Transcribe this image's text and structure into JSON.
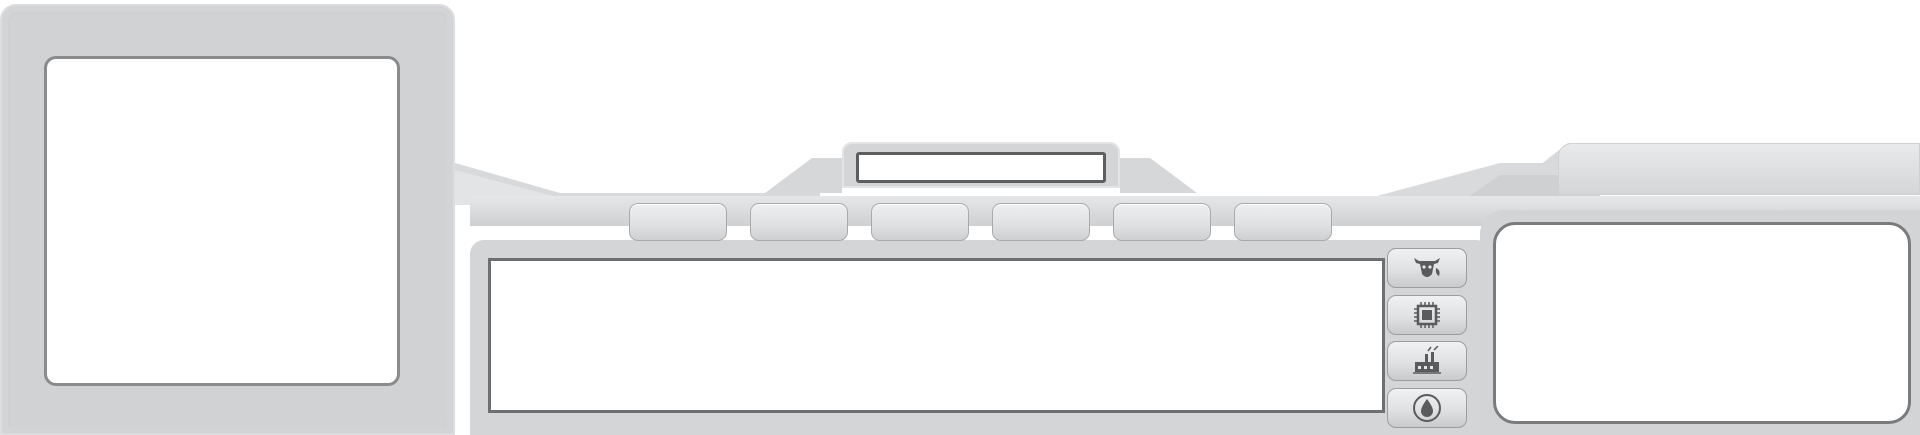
{
  "title_bar": {
    "text": ""
  },
  "tabs": [
    {
      "label": ""
    },
    {
      "label": ""
    },
    {
      "label": ""
    },
    {
      "label": ""
    },
    {
      "label": ""
    },
    {
      "label": ""
    }
  ],
  "side_buttons": [
    {
      "icon": "cow-icon"
    },
    {
      "icon": "chip-icon"
    },
    {
      "icon": "factory-icon"
    },
    {
      "icon": "water-drop-icon"
    }
  ],
  "colors": {
    "frame": "#d3d4d6",
    "border_dark": "#6e6f71",
    "panel_white": "#ffffff",
    "icon": "#555658"
  }
}
